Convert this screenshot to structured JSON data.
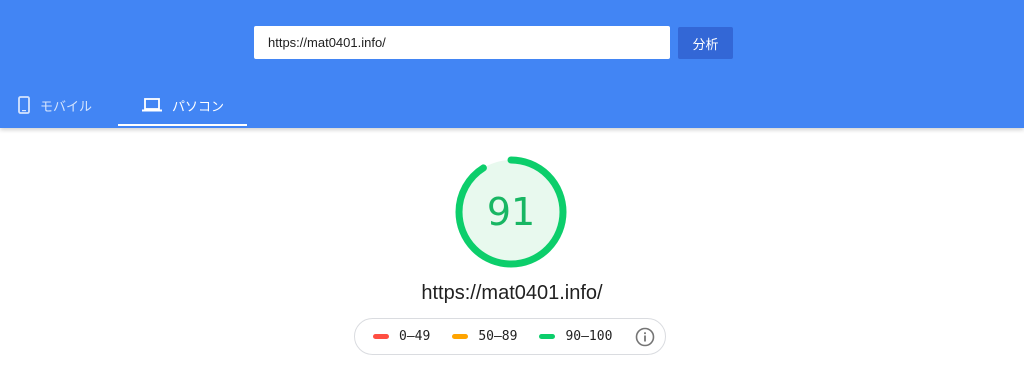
{
  "search": {
    "value": "https://mat0401.info/",
    "button_label": "分析"
  },
  "tabs": [
    {
      "label": "モバイル",
      "icon": "smartphone-icon",
      "selected": false
    },
    {
      "label": "パソコン",
      "icon": "laptop-icon",
      "selected": true
    }
  ],
  "result": {
    "score": "91",
    "score_fraction": 0.91,
    "url": "https://mat0401.info/"
  },
  "legend": {
    "items": [
      {
        "label": "0–49",
        "color": "#ff4e42"
      },
      {
        "label": "50–89",
        "color": "#ffa400"
      },
      {
        "label": "90–100",
        "color": "#0cce6b"
      }
    ],
    "info_icon": "info-icon"
  },
  "colors": {
    "header": "#4285f4",
    "button": "#3367d6",
    "pass": "#0cce6b",
    "pass_text": "#18b663",
    "gauge_fill": "#e8f9ee"
  }
}
